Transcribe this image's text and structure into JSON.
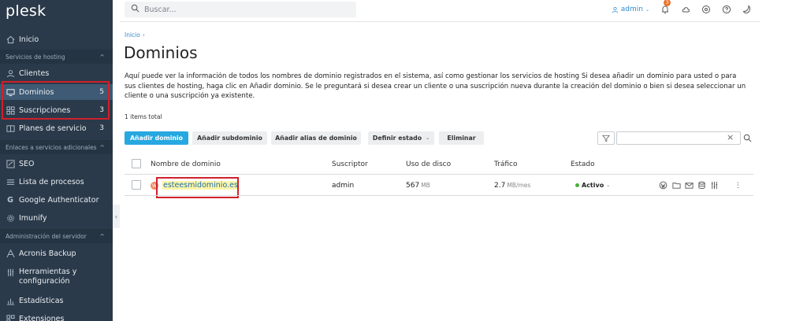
{
  "app": {
    "logo": "plesk"
  },
  "sidebar": {
    "home": "Inicio",
    "sections": [
      {
        "title": "Servicios de hosting"
      },
      {
        "title": "Enlaces a servicios adicionales"
      },
      {
        "title": "Administración del servidor"
      }
    ],
    "hosting_items": [
      {
        "label": "Clientes",
        "count": ""
      },
      {
        "label": "Dominios",
        "count": "5"
      },
      {
        "label": "Suscripciones",
        "count": "3"
      },
      {
        "label": "Planes de servicio",
        "count": "3"
      }
    ],
    "links_items": [
      {
        "label": "SEO"
      },
      {
        "label": "Lista de procesos"
      },
      {
        "label": "Google Authenticator"
      },
      {
        "label": "Imunify"
      }
    ],
    "admin_items": [
      {
        "label": "Acronis Backup"
      },
      {
        "label": "Herramientas y configuración"
      },
      {
        "label": "Estadísticas"
      },
      {
        "label": "Extensiones"
      }
    ],
    "collapse_glyph": "‹"
  },
  "header": {
    "search_placeholder": "Buscar...",
    "user": "admin",
    "notifications_count": "3"
  },
  "main": {
    "breadcrumb": "Inicio",
    "title": "Dominios",
    "description": "Aquí puede ver la información de todos los nombres de dominio registrados en el sistema, así como gestionar los servicios de hosting Si desea añadir un dominio para usted o para sus clientes de hosting, haga clic en Añadir dominio. Se le preguntará si desea crear un cliente o una suscripción nueva durante la creación del dominio o bien si desea seleccionar un cliente o una suscripción ya existente.",
    "items_total": "1 items total",
    "toolbar": {
      "add_domain": "Añadir dominio",
      "add_subdomain": "Añadir subdominio",
      "add_alias": "Añadir alias de dominio",
      "set_status": "Definir estado",
      "delete": "Eliminar"
    },
    "table": {
      "columns": [
        "Nombre de dominio",
        "Suscriptor",
        "Uso de disco",
        "Tráfico",
        "Estado"
      ],
      "rows": [
        {
          "domain": "esteesmidominio.es",
          "subscriber": "admin",
          "disk_value": "567",
          "disk_unit": "MB",
          "traffic_value": "2.7",
          "traffic_unit": "MB/mes",
          "status": "Activo"
        }
      ]
    }
  },
  "colors": {
    "sidebar_bg": "#2b3a4a",
    "sidebar_active": "#3e5a74",
    "primary_button": "#28a8e0",
    "link": "#1a6fb0",
    "highlight_box": "#d0202a",
    "status_active": "#4caf3c"
  }
}
